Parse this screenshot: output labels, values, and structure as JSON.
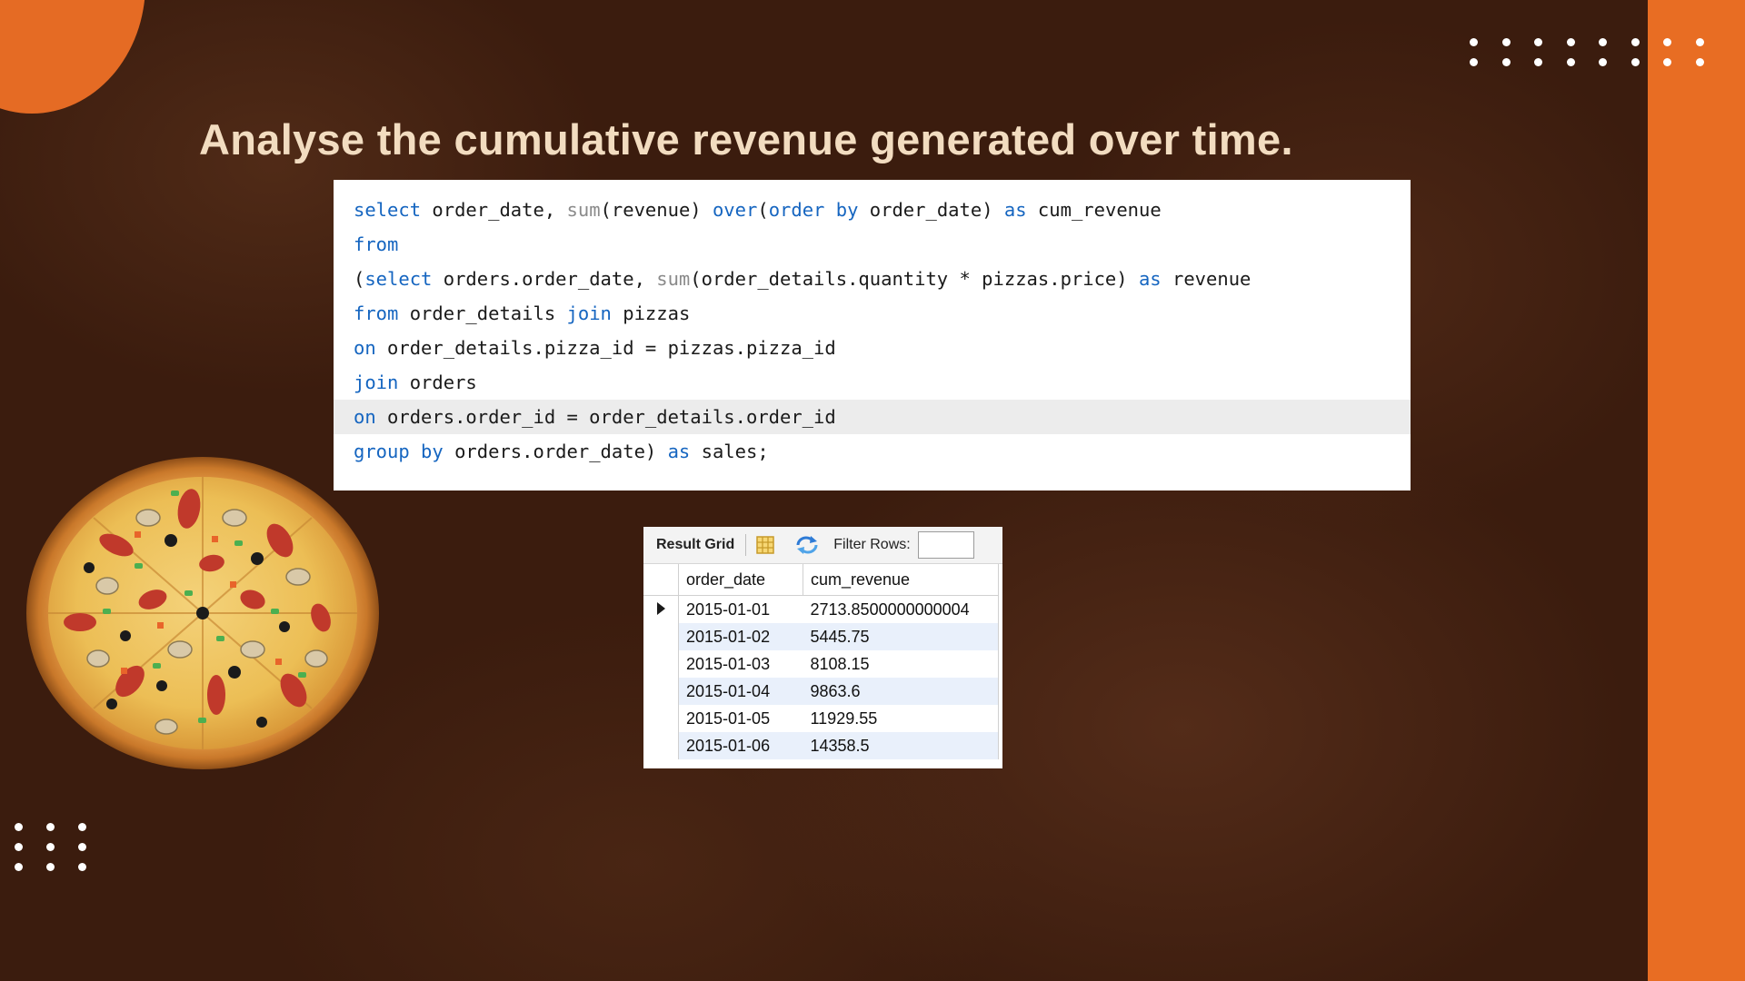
{
  "slide": {
    "title": "Analyse the cumulative revenue generated over time."
  },
  "sql_editor": {
    "lines": [
      [
        {
          "t": "select",
          "c": "kw"
        },
        {
          "t": " order_date, "
        },
        {
          "t": "sum",
          "c": "fn"
        },
        {
          "t": "(revenue) "
        },
        {
          "t": "over",
          "c": "kw"
        },
        {
          "t": "("
        },
        {
          "t": "order by",
          "c": "kw"
        },
        {
          "t": " order_date) "
        },
        {
          "t": "as",
          "c": "kw"
        },
        {
          "t": " cum_revenue"
        }
      ],
      [
        {
          "t": "from",
          "c": "kw"
        }
      ],
      [
        {
          "t": "("
        },
        {
          "t": "select",
          "c": "kw"
        },
        {
          "t": " orders.order_date, "
        },
        {
          "t": "sum",
          "c": "fn"
        },
        {
          "t": "(order_details.quantity * pizzas.price) "
        },
        {
          "t": "as",
          "c": "kw"
        },
        {
          "t": " revenue"
        }
      ],
      [
        {
          "t": "from",
          "c": "kw"
        },
        {
          "t": " order_details "
        },
        {
          "t": "join",
          "c": "kw"
        },
        {
          "t": " pizzas"
        }
      ],
      [
        {
          "t": "on",
          "c": "kw"
        },
        {
          "t": " order_details.pizza_id = pizzas.pizza_id"
        }
      ],
      [
        {
          "t": "join",
          "c": "kw"
        },
        {
          "t": " orders"
        }
      ],
      [
        {
          "t": "on",
          "c": "kw"
        },
        {
          "t": " orders.order_id = order_details.order_id"
        }
      ],
      [
        {
          "t": "group by",
          "c": "kw"
        },
        {
          "t": " orders.order_date) "
        },
        {
          "t": "as",
          "c": "kw"
        },
        {
          "t": " sales;"
        }
      ]
    ],
    "highlighted_line": 6
  },
  "result_grid": {
    "tab_label": "Result Grid",
    "filter_label": "Filter Rows:",
    "filter_value": "",
    "columns": [
      "order_date",
      "cum_revenue"
    ],
    "rows": [
      [
        "2015-01-01",
        "2713.8500000000004"
      ],
      [
        "2015-01-02",
        "5445.75"
      ],
      [
        "2015-01-03",
        "8108.15"
      ],
      [
        "2015-01-04",
        "9863.6"
      ],
      [
        "2015-01-05",
        "11929.55"
      ],
      [
        "2015-01-06",
        "14358.5"
      ]
    ],
    "current_row": 0
  },
  "colors": {
    "accent": "#e86d23",
    "background": "#3b1c0e",
    "title": "#f2dcc0",
    "sql_keyword": "#1565c0"
  },
  "icons": {
    "grid": "result-grid-icon",
    "refresh": "refresh-icon",
    "row_pointer": "current-row-arrow-icon"
  }
}
